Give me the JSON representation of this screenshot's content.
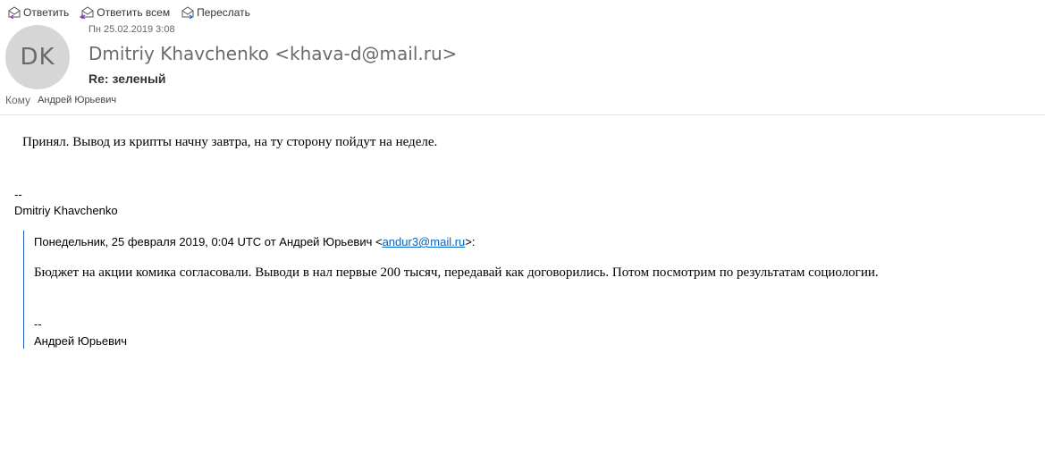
{
  "toolbar": {
    "reply_label": "Ответить",
    "reply_all_label": "Ответить всем",
    "forward_label": "Переслать"
  },
  "message": {
    "avatar_initials": "DK",
    "date": "Пн 25.02.2019 3:08",
    "sender": "Dmitriy Khavchenko <khava-d@mail.ru>",
    "subject": "Re: зеленый",
    "to_label": "Кому",
    "to_value": "Андрей Юрьевич",
    "body": "Принял. Вывод из крипты начну завтра, на ту сторону пойдут на неделе.",
    "signature_dash": "--",
    "signature_name": "Dmitriy Khavchenko"
  },
  "quoted": {
    "header_prefix": "Понедельник, 25 февраля 2019, 0:04 UTC от Андрей Юрьевич <",
    "email": "andur3@mail.ru",
    "header_suffix": ">:",
    "body": "Бюджет на акции комика согласовали. Выводи в нал первые 200 тысяч, передавай как договорились. Потом посмотрим по результатам социологии.",
    "signature_dash": "--",
    "signature_name": "Андрей Юрьевич"
  },
  "colors": {
    "link": "#0563c1",
    "quote_border": "#1f5fbf",
    "avatar_bg": "#d6d6d6"
  }
}
